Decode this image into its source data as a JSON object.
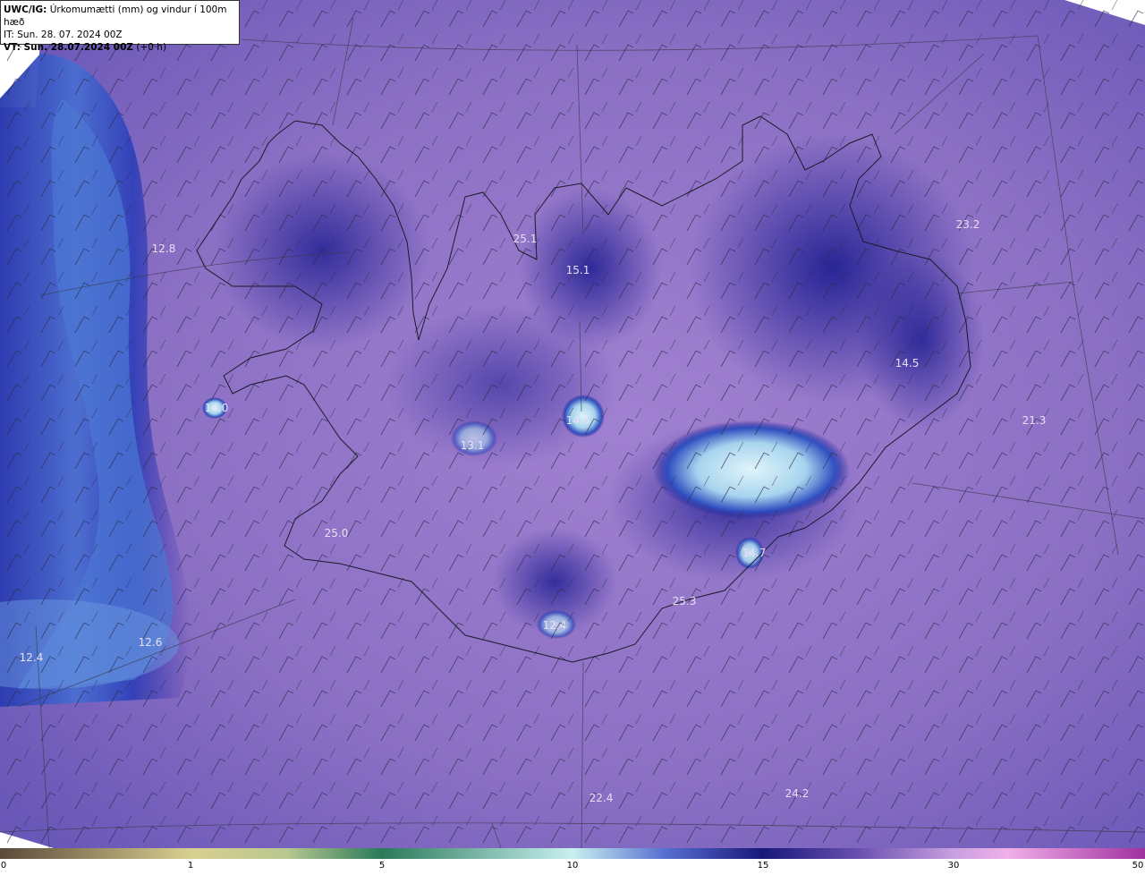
{
  "header": {
    "model": "UWC/IG:",
    "title": "Úrkomumætti (mm) og vindur í 100m hæð",
    "it_label": "IT:",
    "it_value": "Sun. 28. 07. 2024 00Z",
    "vt_label": "VT: Sun. 28.07.2024 00Z",
    "vt_suffix": "(+0 h)"
  },
  "value_labels": [
    "12.8",
    "25.1",
    "15.1",
    "23.2",
    "14.5",
    "21.3",
    "14.0",
    "13.1",
    "14.6",
    "14.7",
    "25.0",
    "25.3",
    "12.4",
    "12.6",
    "12.4",
    "22.4",
    "24.2"
  ],
  "colorbar": {
    "ticks": [
      "0",
      "1",
      "5",
      "10",
      "15",
      "30",
      "50"
    ],
    "colors": [
      "#5a4a3a",
      "#c8b060",
      "#d8d890",
      "#3a8a6a",
      "#a0e8e0",
      "#3040b0",
      "#18187a",
      "#8a6ac0",
      "#e8a8e0",
      "#b83ab0"
    ]
  },
  "colors": {
    "background": "#8a6cc0",
    "dry": "#9a7ccc",
    "wet": "#2a2aa0",
    "very_wet": "#b8e0f0",
    "coastline": "#222222"
  }
}
